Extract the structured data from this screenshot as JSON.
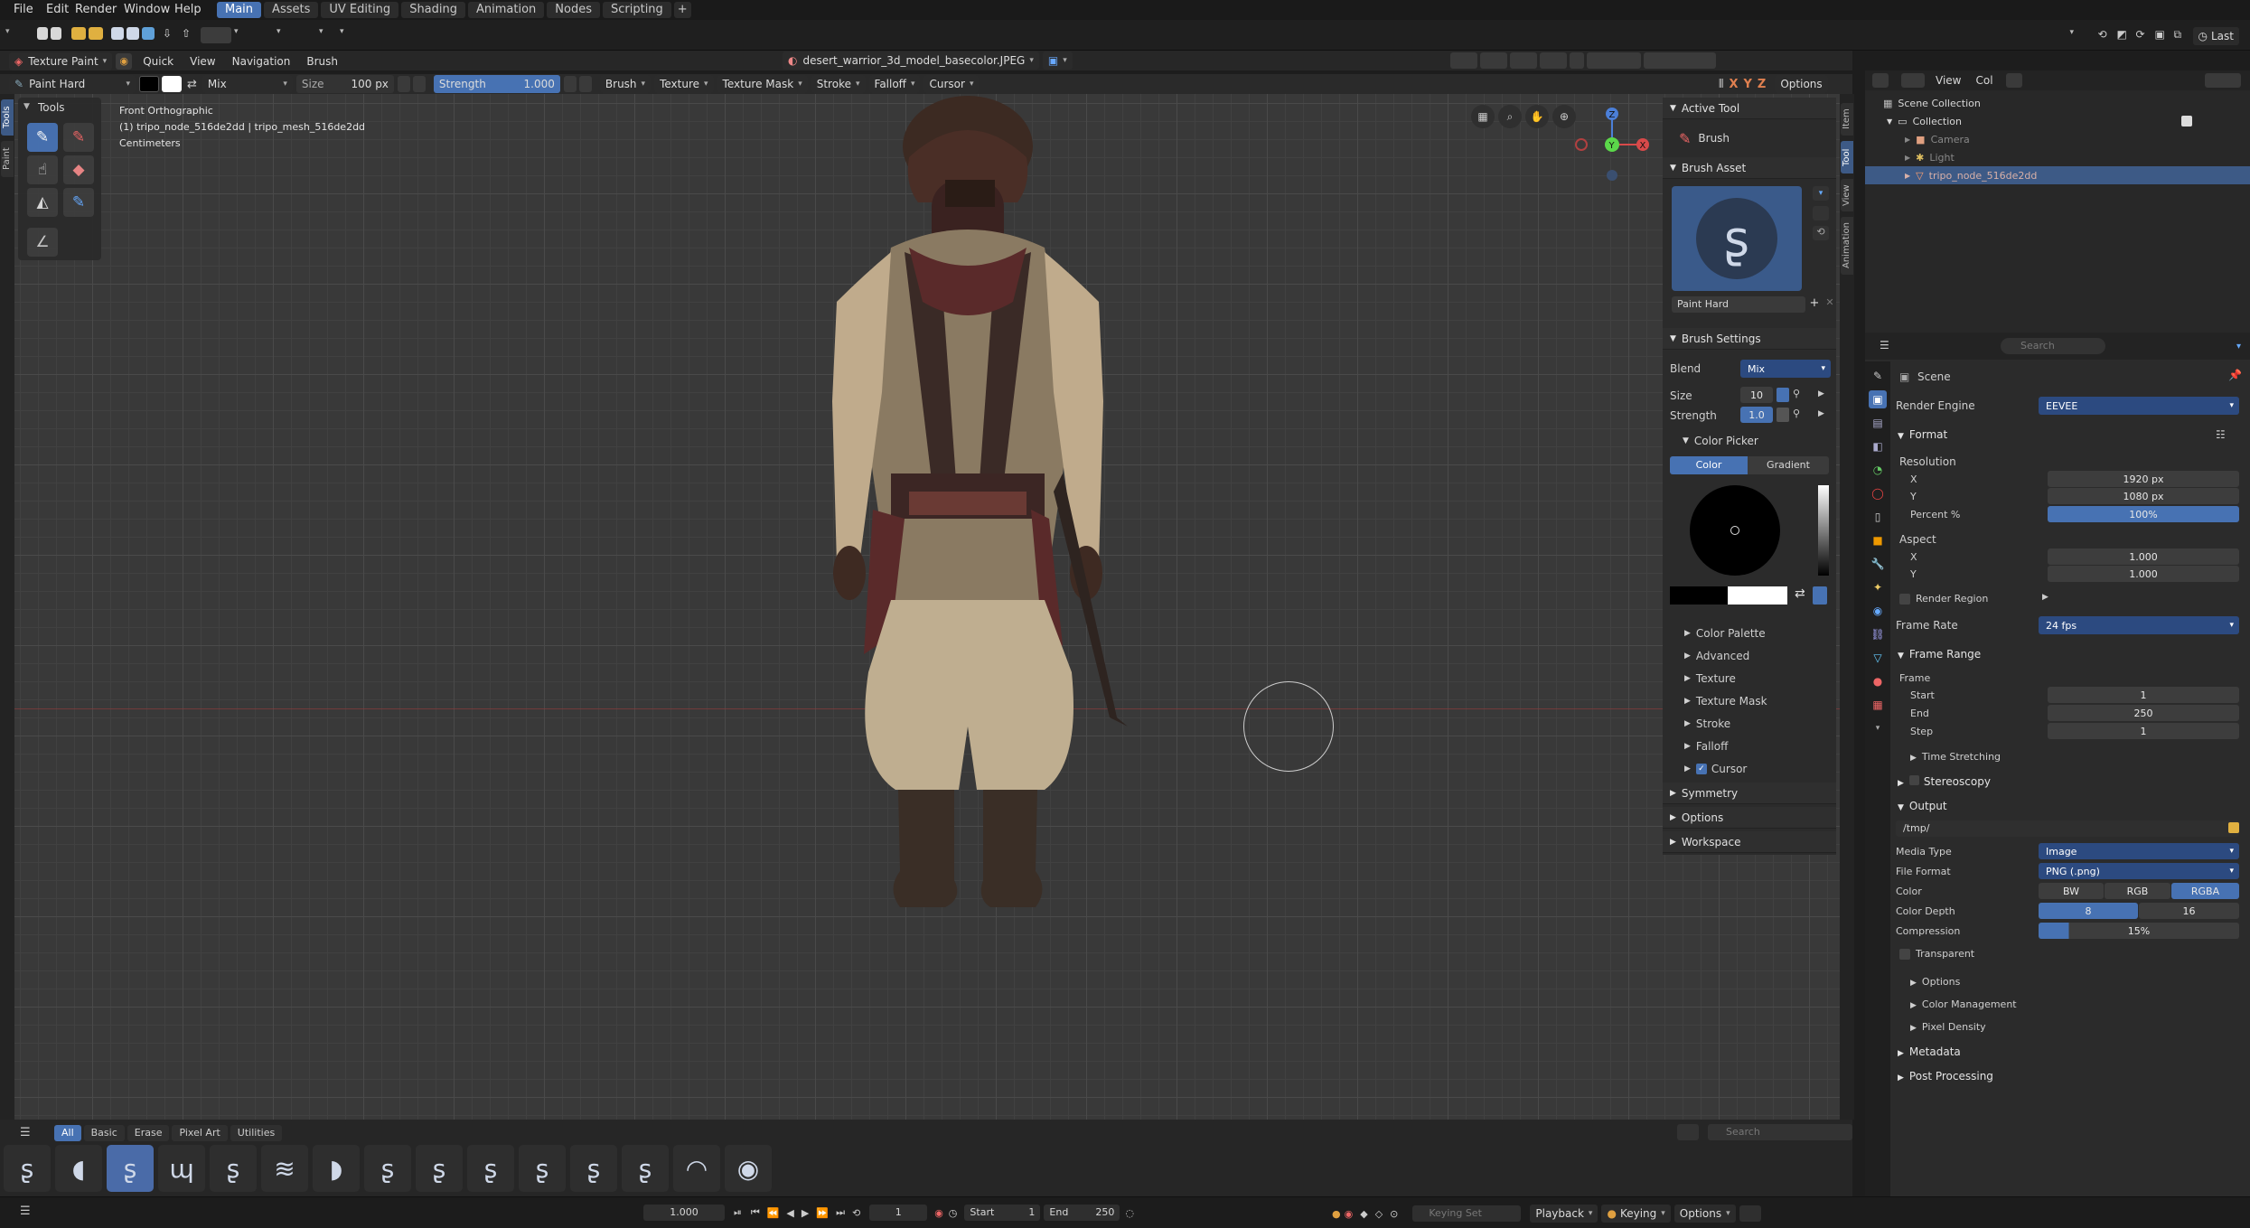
{
  "menu": [
    "File",
    "Edit",
    "Render",
    "Window",
    "Help"
  ],
  "workspaces": [
    "Main",
    "Assets",
    "UV Editing",
    "Shading",
    "Animation",
    "Nodes",
    "Scripting"
  ],
  "topright": {
    "last": "Last"
  },
  "header": {
    "mode": "Texture Paint",
    "menus": [
      "Quick",
      "View",
      "Navigation",
      "Brush"
    ],
    "image_name": "desert_warrior_3d_model_basecolor.JPEG"
  },
  "toolheader": {
    "brush": "Paint Hard",
    "blend": "Mix",
    "size_label": "Size",
    "size_value": "100 px",
    "strength_label": "Strength",
    "strength_value": "1.000",
    "menus": [
      "Brush",
      "Texture",
      "Texture Mask",
      "Stroke",
      "Falloff",
      "Cursor"
    ],
    "options": "Options",
    "axes": [
      "X",
      "Y",
      "Z"
    ]
  },
  "tools_title": "Tools",
  "side_tabs_left": [
    "Tools",
    "Paint"
  ],
  "side_tabs_right": [
    "Item",
    "Tool",
    "View",
    "Animation"
  ],
  "overlay": {
    "line1": "Front Orthographic",
    "line2": "(1) tripo_node_516de2dd | tripo_mesh_516de2dd",
    "line3": "Centimeters"
  },
  "gizmo": {
    "x": "X",
    "y": "Y",
    "z": "Z"
  },
  "npanel": {
    "active_tool": "Active Tool",
    "tool_name": "Brush",
    "brush_asset": "Brush Asset",
    "brush_name": "Paint Hard",
    "brush_settings": "Brush Settings",
    "blend_label": "Blend",
    "blend_value": "Mix",
    "size_label": "Size",
    "size_value": "10",
    "strength_label": "Strength",
    "strength_value": "1.0",
    "color_picker": "Color Picker",
    "tab_color": "Color",
    "tab_gradient": "Gradient",
    "subs": [
      "Color Palette",
      "Advanced",
      "Texture",
      "Texture Mask",
      "Stroke",
      "Falloff",
      "Cursor"
    ],
    "panels": [
      "Symmetry",
      "Options",
      "Workspace"
    ]
  },
  "brush_filters": [
    "All",
    "Basic",
    "Erase",
    "Pixel Art",
    "Utilities"
  ],
  "brush_search": "Search",
  "brush_count": 15,
  "outliner": {
    "view": "View",
    "col": "Col",
    "root": "Scene Collection",
    "collection": "Collection",
    "items": [
      "Camera",
      "Light",
      "tripo_node_516de2dd"
    ]
  },
  "props": {
    "search": "Search",
    "scene": "Scene",
    "render_engine_label": "Render Engine",
    "render_engine": "EEVEE",
    "format": "Format",
    "resolution": "Resolution",
    "res_x": "1920 px",
    "res_y": "1080 px",
    "percent_label": "Percent %",
    "percent": "100%",
    "aspect": "Aspect",
    "asp_x": "1.000",
    "asp_y": "1.000",
    "render_region": "Render Region",
    "frame_rate_label": "Frame Rate",
    "frame_rate": "24 fps",
    "frame_range": "Frame Range",
    "frame": "Frame",
    "start_label": "Start",
    "start": "1",
    "end_label": "End",
    "end": "250",
    "step_label": "Step",
    "step": "1",
    "time_stretching": "Time Stretching",
    "stereoscopy": "Stereoscopy",
    "output": "Output",
    "path": "/tmp/",
    "media_type_label": "Media Type",
    "media_type": "Image",
    "file_format_label": "File Format",
    "file_format": "PNG (.png)",
    "color_label": "Color",
    "color_opts": [
      "BW",
      "RGB",
      "RGBA"
    ],
    "depth_label": "Color Depth",
    "depth_opts": [
      "8",
      "16"
    ],
    "compression_label": "Compression",
    "compression": "15%",
    "transparent": "Transparent",
    "out_subs": [
      "Options",
      "Color Management",
      "Pixel Density"
    ],
    "metadata": "Metadata",
    "post": "Post Processing",
    "xy": [
      "X",
      "Y"
    ]
  },
  "timeline": {
    "speed": "1.000",
    "frame": "1",
    "start_label": "Start",
    "start": "1",
    "end_label": "End",
    "end": "250",
    "keying_set": "Keying Set",
    "playback": "Playback",
    "keying": "Keying",
    "options": "Options"
  },
  "colors": {
    "accent": "#4772b3",
    "header": "#1a1a1a",
    "panel": "#2b2b2b",
    "viewport": "#393939",
    "selected": "#3d5a86"
  }
}
